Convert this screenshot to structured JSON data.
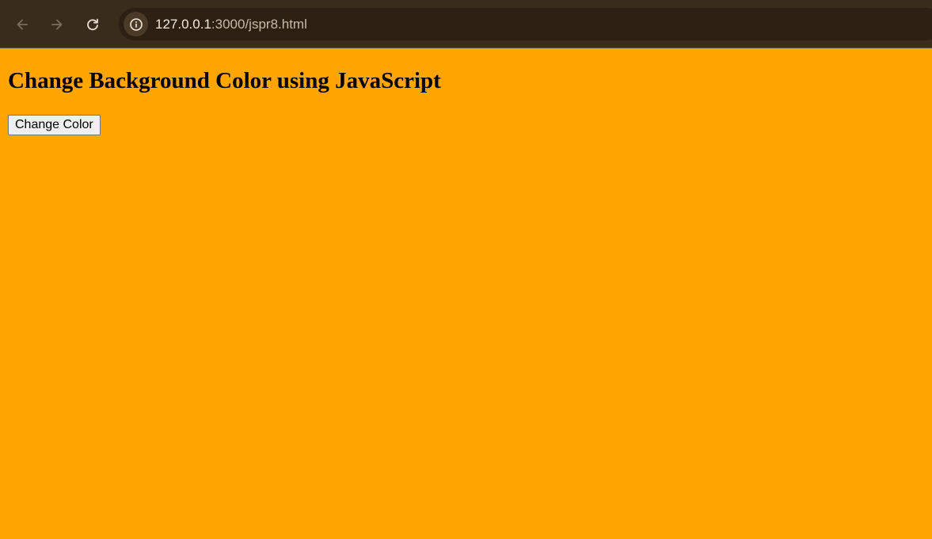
{
  "browser": {
    "url_host": "127.0.0.1",
    "url_path": ":3000/jspr8.html",
    "icons": {
      "back": "back-arrow-icon",
      "forward": "forward-arrow-icon",
      "reload": "reload-icon",
      "site_info": "info-icon"
    }
  },
  "page": {
    "title": "Change Background Color using JavaScript",
    "button_label": "Change Color",
    "background_color": "#FFA500"
  }
}
